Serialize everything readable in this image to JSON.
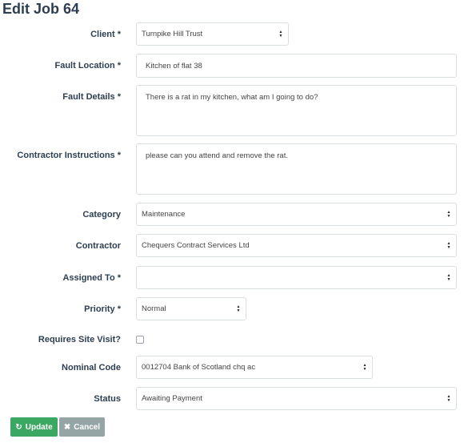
{
  "page": {
    "title": "Edit Job 64"
  },
  "form": {
    "client": {
      "label": "Client *",
      "value": "Turnpike Hill Trust"
    },
    "fault_location": {
      "label": "Fault Location *",
      "value": "Kitchen of flat 38"
    },
    "fault_details": {
      "label": "Fault Details *",
      "value": "There is a rat in my kitchen, what am I going to do?"
    },
    "contractor_instructions": {
      "label": "Contractor Instructions *",
      "value": "please can you attend and remove the rat."
    },
    "category": {
      "label": "Category",
      "value": "Maintenance"
    },
    "contractor": {
      "label": "Contractor",
      "value": "Chequers Contract Services Ltd"
    },
    "assigned_to": {
      "label": "Assigned To *",
      "value": ""
    },
    "priority": {
      "label": "Priority *",
      "value": "Normal"
    },
    "requires_site_visit": {
      "label": "Requires Site Visit?",
      "checked": false
    },
    "nominal_code": {
      "label": "Nominal Code",
      "value": "0012704 Bank of Scotland chq ac"
    },
    "status": {
      "label": "Status",
      "value": "Awaiting Payment"
    }
  },
  "actions": {
    "update": {
      "label": "Update",
      "icon": "refresh-icon",
      "color": "#3aa862"
    },
    "cancel": {
      "label": "Cancel",
      "icon": "close-icon",
      "color": "#95a5a6"
    }
  },
  "colors": {
    "label": "#2c3e50",
    "border": "#d9dee3"
  }
}
